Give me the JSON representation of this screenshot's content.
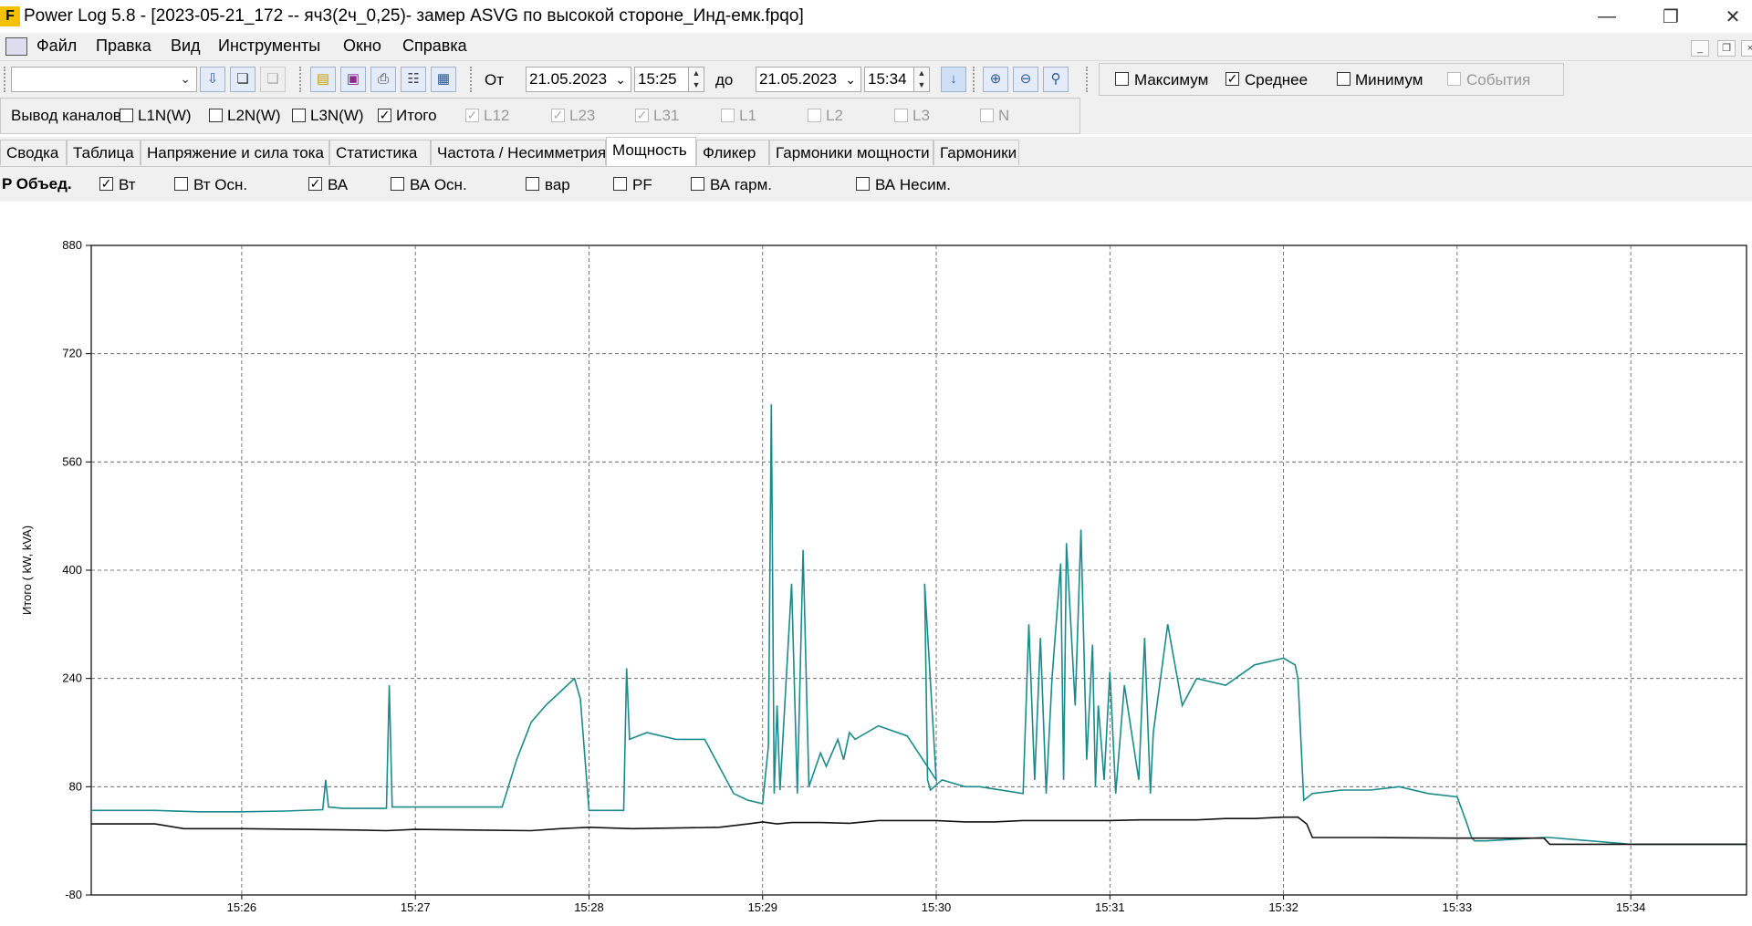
{
  "window": {
    "title": "Power Log 5.8 - [2023-05-21_172 -- яч3(2ч_0,25)- замер ASVG по высокой стороне_Инд-емк.fpqo]",
    "logo_letter": "F"
  },
  "menu": [
    "Файл",
    "Правка",
    "Вид",
    "Инструменты",
    "Окно",
    "Справка"
  ],
  "toolbar": {
    "from_label": "От",
    "to_label": "до",
    "from_date": "21.05.2023",
    "from_time": "15:25",
    "to_date": "21.05.2023",
    "to_time": "15:34",
    "stats": [
      {
        "label": "Максимум",
        "checked": false,
        "enabled": true
      },
      {
        "label": "Среднее",
        "checked": true,
        "enabled": true
      },
      {
        "label": "Минимум",
        "checked": false,
        "enabled": true
      },
      {
        "label": "События",
        "checked": false,
        "enabled": false
      }
    ]
  },
  "channels": {
    "label": "Вывод каналов",
    "items": [
      {
        "label": "L1N(W)",
        "checked": false,
        "enabled": true
      },
      {
        "label": "L2N(W)",
        "checked": false,
        "enabled": true
      },
      {
        "label": "L3N(W)",
        "checked": false,
        "enabled": true
      },
      {
        "label": "Итого",
        "checked": true,
        "enabled": true
      },
      {
        "label": "L12",
        "checked": true,
        "enabled": false
      },
      {
        "label": "L23",
        "checked": true,
        "enabled": false
      },
      {
        "label": "L31",
        "checked": true,
        "enabled": false
      },
      {
        "label": "L1",
        "checked": false,
        "enabled": false
      },
      {
        "label": "L2",
        "checked": false,
        "enabled": false
      },
      {
        "label": "L3",
        "checked": false,
        "enabled": false
      },
      {
        "label": "N",
        "checked": false,
        "enabled": false
      }
    ]
  },
  "tabs": [
    {
      "label": "Сводка",
      "active": false
    },
    {
      "label": "Таблица",
      "active": false
    },
    {
      "label": "Напряжение и сила тока",
      "active": false
    },
    {
      "label": "Статистика",
      "active": false
    },
    {
      "label": "Частота / Несимметрия",
      "active": false
    },
    {
      "label": "Мощность",
      "active": true
    },
    {
      "label": "Фликер",
      "active": false
    },
    {
      "label": "Гармоники мощности",
      "active": false
    },
    {
      "label": "Гармоники",
      "active": false
    }
  ],
  "power": {
    "title": "P Объед.",
    "options": [
      {
        "label": "Вт",
        "checked": true
      },
      {
        "label": "Вт Осн.",
        "checked": false
      },
      {
        "label": "ВА",
        "checked": true
      },
      {
        "label": "ВА Осн.",
        "checked": false
      },
      {
        "label": "вар",
        "checked": false
      },
      {
        "label": "PF",
        "checked": false
      },
      {
        "label": "ВА гарм.",
        "checked": false
      },
      {
        "label": "ВА Несим.",
        "checked": false
      }
    ]
  },
  "chart_data": {
    "type": "line",
    "ylabel": "Итого ( kW, kVA)",
    "ylim": [
      -80,
      880
    ],
    "yticks": [
      -80,
      80,
      240,
      400,
      560,
      720,
      880
    ],
    "xlim": [
      "15:25:08",
      "15:34:40"
    ],
    "xticks": [
      "15:26",
      "15:27",
      "15:28",
      "15:29",
      "15:30",
      "15:31",
      "15:32",
      "15:33",
      "15:34"
    ],
    "grid": true,
    "colors": {
      "va": "#1a8a8a",
      "w": "#111111"
    },
    "series": [
      {
        "key": "va",
        "x": [
          "15:25:08",
          "15:25:30",
          "15:25:45",
          "15:26:00",
          "15:26:15",
          "15:26:28",
          "15:26:29",
          "15:26:30",
          "15:26:35",
          "15:26:45",
          "15:26:50",
          "15:26:51",
          "15:26:52",
          "15:27:10",
          "15:27:30",
          "15:27:35",
          "15:27:40",
          "15:27:45",
          "15:27:50",
          "15:27:55",
          "15:27:57",
          "15:28:00",
          "15:28:12",
          "15:28:13",
          "15:28:14",
          "15:28:20",
          "15:28:30",
          "15:28:40",
          "15:28:50",
          "15:28:55",
          "15:29:00",
          "15:29:02",
          "15:29:03",
          "15:29:04",
          "15:29:05",
          "15:29:06",
          "15:29:10",
          "15:29:12",
          "15:29:14",
          "15:29:16",
          "15:29:20",
          "15:29:22",
          "15:29:26",
          "15:29:28",
          "15:29:30",
          "15:29:32",
          "15:29:40",
          "15:29:50",
          "15:30:00",
          "15:29:56",
          "15:29:57",
          "15:29:58",
          "15:30:02",
          "15:30:10",
          "15:30:15",
          "15:30:30",
          "15:30:32",
          "15:30:34",
          "15:30:36",
          "15:30:38",
          "15:30:40",
          "15:30:43",
          "15:30:44",
          "15:30:45",
          "15:30:48",
          "15:30:50",
          "15:30:52",
          "15:30:54",
          "15:30:55",
          "15:30:56",
          "15:30:58",
          "15:31:00",
          "15:31:02",
          "15:31:05",
          "15:31:10",
          "15:31:12",
          "15:31:14",
          "15:31:15",
          "15:31:20",
          "15:31:25",
          "15:31:30",
          "15:31:40",
          "15:31:50",
          "15:32:00",
          "15:32:04",
          "15:32:05",
          "15:32:07",
          "15:32:10",
          "15:32:20",
          "15:32:30",
          "15:32:40",
          "15:32:50",
          "15:33:00",
          "15:33:03",
          "15:33:05",
          "15:33:06",
          "15:33:10",
          "15:33:30",
          "15:33:32",
          "15:34:00",
          "15:34:40"
        ],
        "values": [
          45,
          45,
          43,
          43,
          44,
          46,
          90,
          50,
          48,
          48,
          48,
          230,
          50,
          50,
          50,
          120,
          175,
          200,
          220,
          240,
          210,
          45,
          45,
          255,
          150,
          160,
          150,
          150,
          70,
          60,
          55,
          140,
          645,
          70,
          200,
          75,
          380,
          70,
          430,
          80,
          130,
          110,
          150,
          120,
          160,
          150,
          170,
          155,
          90,
          380,
          90,
          75,
          90,
          80,
          80,
          70,
          320,
          90,
          300,
          70,
          240,
          410,
          90,
          440,
          200,
          460,
          120,
          290,
          80,
          200,
          90,
          250,
          70,
          230,
          90,
          300,
          70,
          160,
          320,
          200,
          240,
          230,
          260,
          270,
          260,
          240,
          60,
          70,
          75,
          75,
          80,
          70,
          65,
          30,
          5,
          0,
          0,
          5,
          5,
          -5,
          -5
        ]
      },
      {
        "key": "w",
        "x": [
          "15:25:08",
          "15:25:30",
          "15:25:40",
          "15:26:00",
          "15:26:20",
          "15:26:40",
          "15:26:50",
          "15:27:00",
          "15:27:20",
          "15:27:40",
          "15:27:50",
          "15:28:00",
          "15:28:15",
          "15:28:30",
          "15:28:45",
          "15:28:55",
          "15:29:00",
          "15:29:05",
          "15:29:10",
          "15:29:20",
          "15:29:30",
          "15:29:40",
          "15:29:50",
          "15:30:00",
          "15:30:10",
          "15:30:20",
          "15:30:30",
          "15:30:40",
          "15:30:50",
          "15:31:00",
          "15:31:10",
          "15:31:20",
          "15:31:30",
          "15:31:40",
          "15:31:50",
          "15:32:00",
          "15:32:05",
          "15:32:08",
          "15:32:10",
          "15:32:30",
          "15:33:00",
          "15:33:10",
          "15:33:30",
          "15:33:32",
          "15:34:00",
          "15:34:40"
        ],
        "values": [
          25,
          25,
          18,
          18,
          17,
          16,
          15,
          17,
          16,
          15,
          18,
          20,
          18,
          19,
          20,
          25,
          28,
          25,
          27,
          27,
          26,
          30,
          30,
          30,
          28,
          28,
          30,
          30,
          30,
          30,
          31,
          31,
          31,
          33,
          33,
          35,
          35,
          25,
          5,
          5,
          4,
          4,
          4,
          -5,
          -5,
          -5
        ]
      }
    ]
  }
}
